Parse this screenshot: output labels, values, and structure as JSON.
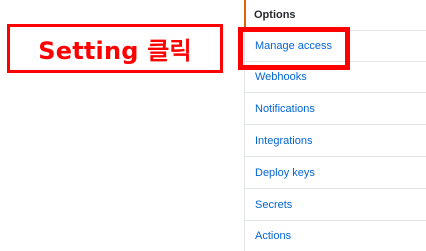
{
  "settings_menu": {
    "items": [
      {
        "label": "Options",
        "selected": true
      },
      {
        "label": "Manage access",
        "selected": false
      },
      {
        "label": "Webhooks",
        "selected": false
      },
      {
        "label": "Notifications",
        "selected": false
      },
      {
        "label": "Integrations",
        "selected": false
      },
      {
        "label": "Deploy keys",
        "selected": false
      },
      {
        "label": "Secrets",
        "selected": false
      },
      {
        "label": "Actions",
        "selected": false
      }
    ]
  },
  "annotation": {
    "callout_text": "Setting 클릭",
    "color": "#ff0000",
    "highlighted_item": "Manage access"
  },
  "colors": {
    "link": "#0366d6",
    "selected_text": "#24292e",
    "selected_accent": "#e36209",
    "divider": "#e1e4e8"
  }
}
